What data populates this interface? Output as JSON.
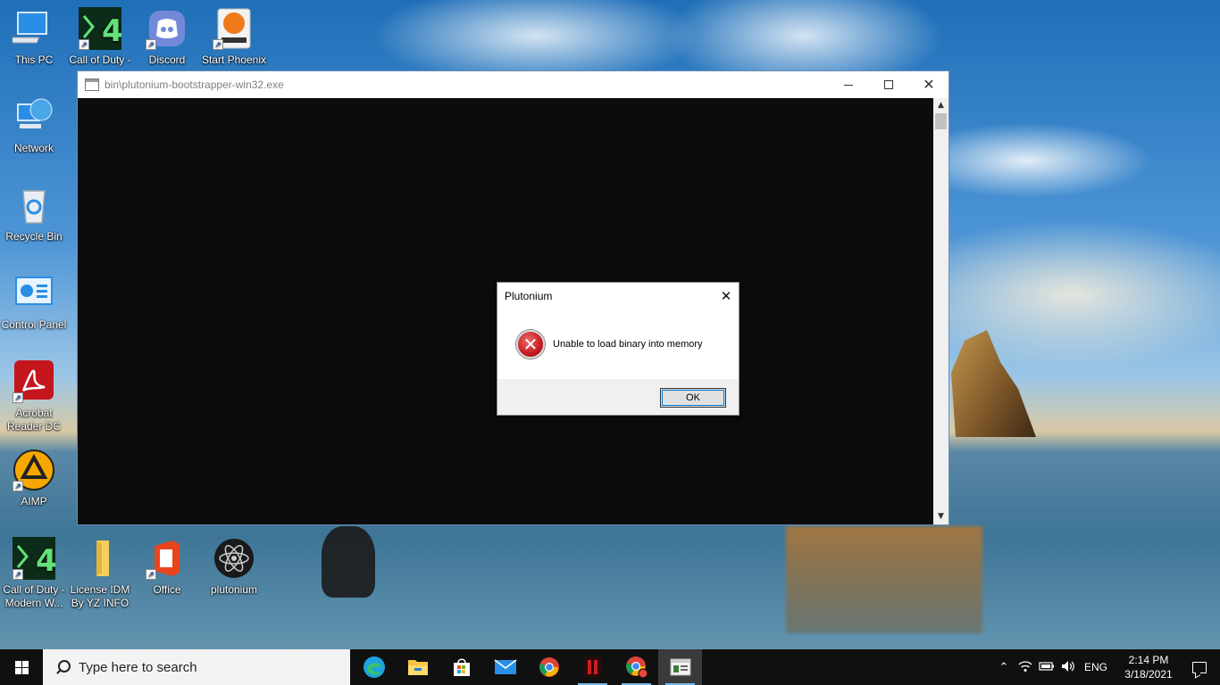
{
  "desktop": {
    "icons": [
      {
        "label": "This PC"
      },
      {
        "label": "Call of Duty - Modern W..."
      },
      {
        "label": "Discord"
      },
      {
        "label": "Start Phoenix OS"
      },
      {
        "label": "Network"
      },
      {
        "label": "Recycle Bin"
      },
      {
        "label": "Control Panel"
      },
      {
        "label": "Acrobat Reader DC"
      },
      {
        "label": "AIMP"
      },
      {
        "label": "Call of Duty - Modern W..."
      },
      {
        "label": "License IDM By YZ INFO"
      },
      {
        "label": "Office"
      },
      {
        "label": "plutonium"
      }
    ]
  },
  "console_window": {
    "title": "bin\\plutonium-bootstrapper-win32.exe",
    "controls": {
      "minimize": "minimize",
      "maximize": "maximize",
      "close": "close"
    }
  },
  "dialog": {
    "title": "Plutonium",
    "close_glyph": "✕",
    "message": "Unable to load binary into memory",
    "error_glyph": "✕",
    "ok_label": "OK"
  },
  "taskbar": {
    "search_placeholder": "Type here to search",
    "pinned_apps": [
      "edge-icon",
      "file-explorer-icon",
      "store-icon",
      "mail-icon",
      "chrome-icon",
      "game-icon",
      "chrome-profile-icon",
      "console-icon"
    ],
    "tray": {
      "language": "ENG",
      "time": "2:14 PM",
      "date": "3/18/2021"
    }
  },
  "colors": {
    "console_bg": "#0c0c0c",
    "taskbar_bg": "#101010",
    "error_red": "#c0171d",
    "accent_blue": "#0078d7"
  }
}
